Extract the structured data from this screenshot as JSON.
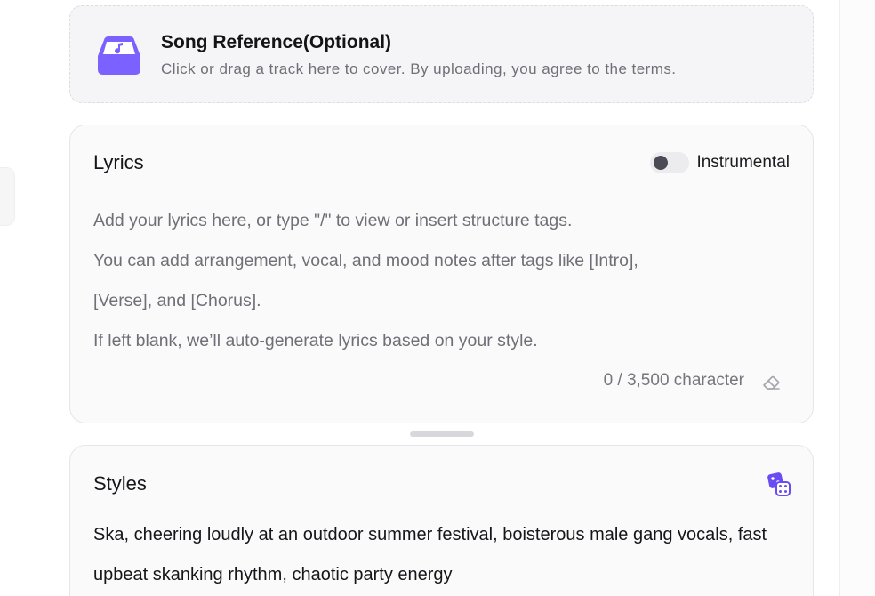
{
  "song_reference": {
    "title": "Song Reference(Optional)",
    "description": "Click or drag a track here to cover. By uploading, you agree to the terms.",
    "accent_color": "#7b61ff"
  },
  "lyrics": {
    "title": "Lyrics",
    "instrumental_label": "Instrumental",
    "instrumental_on": false,
    "placeholder_lines": [
      "Add your lyrics here, or type \"/\" to view or insert structure tags.",
      "You can add arrangement, vocal, and mood notes after tags like [Intro],",
      "[Verse], and [Chorus].",
      "If left blank, we’ll auto-generate lyrics based on your style."
    ],
    "char_count": "0 / 3,500 character",
    "clear_icon": "eraser-icon"
  },
  "styles": {
    "title": "Styles",
    "randomize_icon": "dice-icon",
    "text": "Ska, cheering loudly at an outdoor summer festival, boisterous male gang vocals, fast upbeat skanking rhythm, chaotic party energy"
  }
}
